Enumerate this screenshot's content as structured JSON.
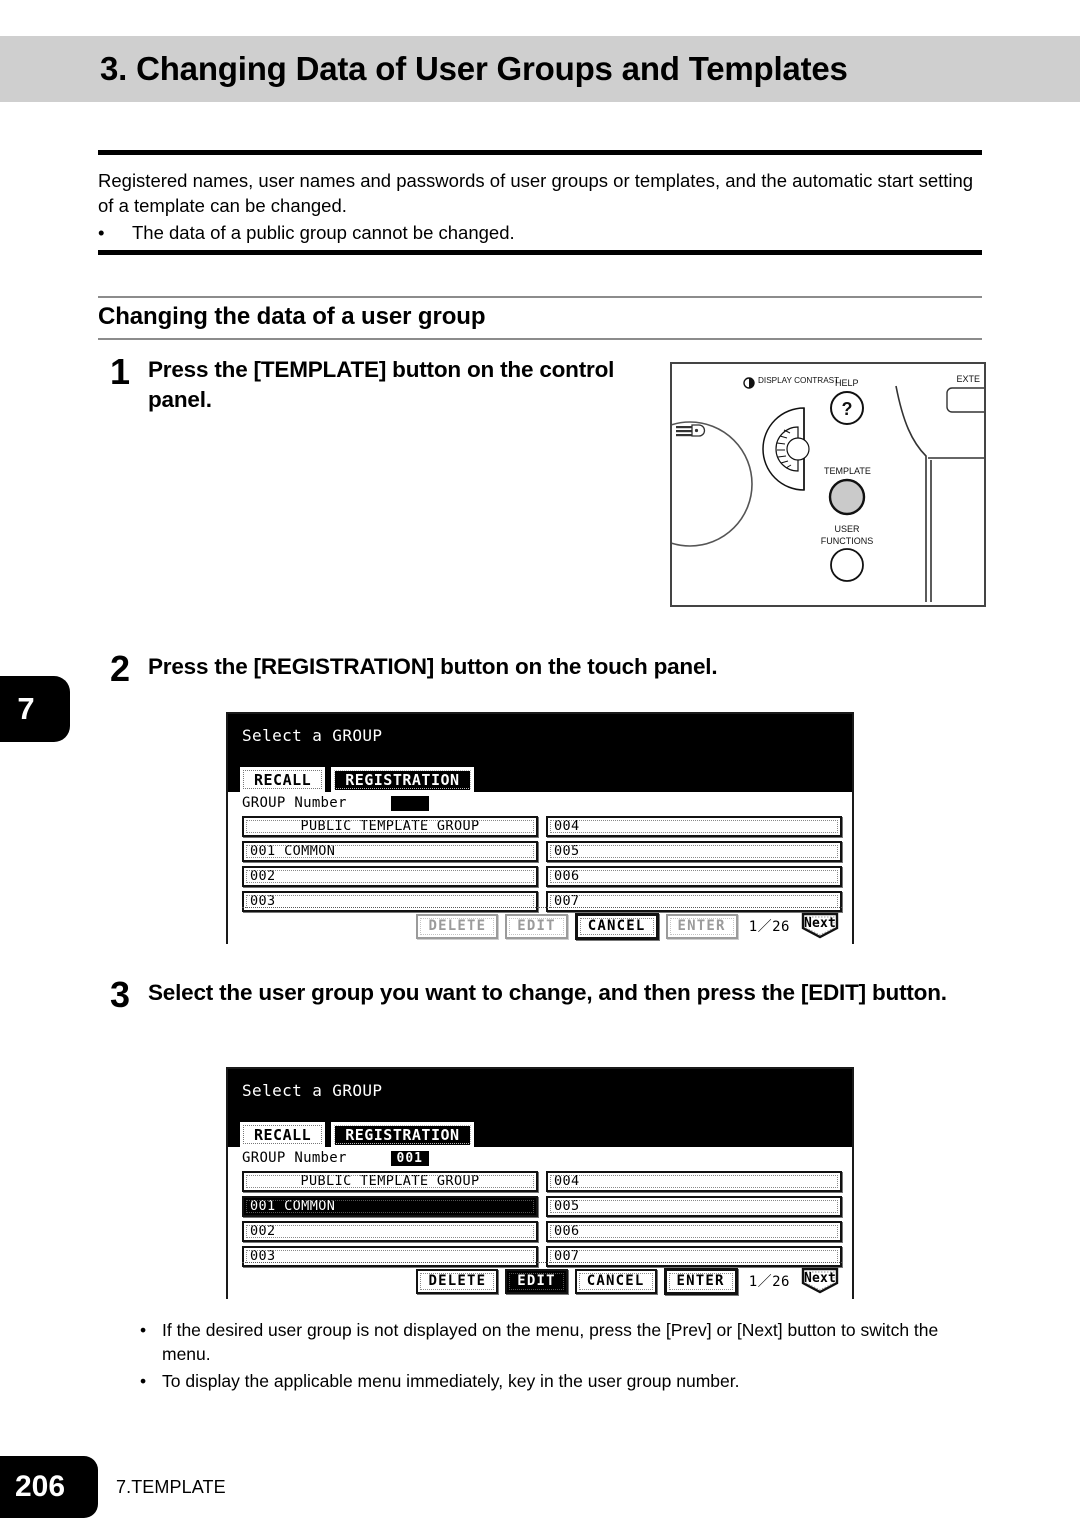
{
  "header": {
    "title": "3. Changing Data of User Groups and Templates"
  },
  "intro": {
    "paragraph": "Registered names, user names and passwords of user groups or templates, and the automatic start setting of a template can be changed.",
    "bullet_marker": "•",
    "bullet": "The data of a public group cannot be changed."
  },
  "subsection": {
    "title": "Changing the data of a user group"
  },
  "steps": [
    {
      "number": "1",
      "text": "Press the [TEMPLATE] button on the control panel."
    },
    {
      "number": "2",
      "text": "Press the [REGISTRATION] button on the touch panel."
    },
    {
      "number": "3",
      "text": "Select the user group you want to change, and then press the [EDIT] button."
    }
  ],
  "chapter_tab": {
    "number": "7"
  },
  "control_panel": {
    "display_contrast_label": "DISPLAY CONTRAST",
    "help_label": "HELP",
    "help_glyph": "?",
    "template_label": "TEMPLATE",
    "user_functions_label_1": "USER",
    "user_functions_label_2": "FUNCTIONS",
    "exte_label": "EXTE"
  },
  "panel1": {
    "prompt": "Select a GROUP",
    "tabs": [
      {
        "label": "RECALL",
        "selected": false
      },
      {
        "label": "REGISTRATION",
        "selected": true
      }
    ],
    "group_number_label": "GROUP Number",
    "group_number_value": "",
    "groups_left": [
      {
        "label": "PUBLIC TEMPLATE GROUP",
        "selected": false,
        "center": true
      },
      {
        "label": "001 COMMON",
        "selected": false,
        "center": false
      },
      {
        "label": "002",
        "selected": false,
        "center": false
      },
      {
        "label": "003",
        "selected": false,
        "center": false
      }
    ],
    "groups_right": [
      {
        "label": "004",
        "selected": false,
        "center": false
      },
      {
        "label": "005",
        "selected": false,
        "center": false
      },
      {
        "label": "006",
        "selected": false,
        "center": false
      },
      {
        "label": "007",
        "selected": false,
        "center": false
      }
    ],
    "actions": [
      {
        "label": "DELETE",
        "state": "disabled"
      },
      {
        "label": "EDIT",
        "state": "disabled"
      },
      {
        "label": "CANCEL",
        "state": "active"
      },
      {
        "label": "ENTER",
        "state": "disabled"
      }
    ],
    "page_count": "1／26",
    "next_label": "Next"
  },
  "panel2": {
    "prompt": "Select a GROUP",
    "tabs": [
      {
        "label": "RECALL",
        "selected": false
      },
      {
        "label": "REGISTRATION",
        "selected": true
      }
    ],
    "group_number_label": "GROUP Number",
    "group_number_value": "001",
    "groups_left": [
      {
        "label": "PUBLIC TEMPLATE GROUP",
        "selected": false,
        "center": true
      },
      {
        "label": "001 COMMON",
        "selected": true,
        "center": false
      },
      {
        "label": "002",
        "selected": false,
        "center": false
      },
      {
        "label": "003",
        "selected": false,
        "center": false
      }
    ],
    "groups_right": [
      {
        "label": "004",
        "selected": false,
        "center": false
      },
      {
        "label": "005",
        "selected": false,
        "center": false
      },
      {
        "label": "006",
        "selected": false,
        "center": false
      },
      {
        "label": "007",
        "selected": false,
        "center": false
      }
    ],
    "actions": [
      {
        "label": "DELETE",
        "state": "active"
      },
      {
        "label": "EDIT",
        "state": "selected"
      },
      {
        "label": "CANCEL",
        "state": "active"
      },
      {
        "label": "ENTER",
        "state": "emphasis"
      }
    ],
    "page_count": "1／26",
    "next_label": "Next"
  },
  "notes": {
    "marker": "•",
    "items": [
      "If the desired user group is not displayed on the menu, press the [Prev] or [Next] button to switch the menu.",
      "To display the applicable menu immediately, key in the user group number."
    ]
  },
  "footer": {
    "page_number": "206",
    "chapter_label": "7.TEMPLATE"
  }
}
